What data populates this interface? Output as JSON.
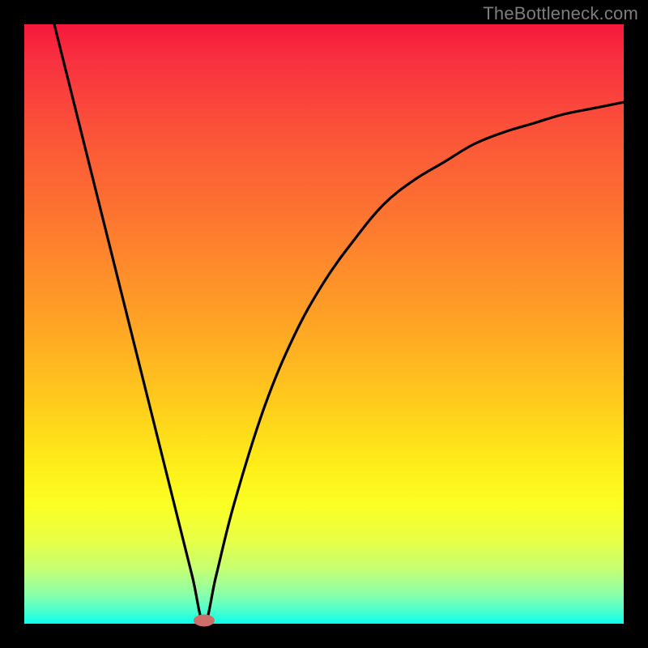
{
  "attribution": "TheBottleneck.com",
  "palette": {
    "gradient_top": "#f6183b",
    "gradient_mid1": "#fd7a2f",
    "gradient_mid2": "#feee19",
    "gradient_bottom": "#0affec",
    "curve": "#000000",
    "marker": "#cc6f6a",
    "frame": "#000000"
  },
  "chart_data": {
    "type": "line",
    "title": "",
    "xlabel": "",
    "ylabel": "",
    "xlim": [
      0,
      100
    ],
    "ylim": [
      0,
      100
    ],
    "grid": false,
    "curve_comment": "V-shaped bottleneck curve: minimum at x≈30, y≈0; left branch steep linear, right branch concave.",
    "dip": {
      "x": 30,
      "y": 0
    },
    "series": [
      {
        "name": "bottleneck-curve",
        "x": [
          5,
          10,
          15,
          20,
          25,
          28,
          30,
          32,
          35,
          40,
          45,
          50,
          55,
          60,
          65,
          70,
          75,
          80,
          85,
          90,
          95,
          100
        ],
        "y": [
          100,
          80,
          60,
          40,
          20,
          8,
          0,
          8,
          20,
          36,
          48,
          57,
          64,
          70,
          74,
          77,
          80,
          82,
          83.5,
          85,
          86,
          87
        ]
      }
    ]
  }
}
